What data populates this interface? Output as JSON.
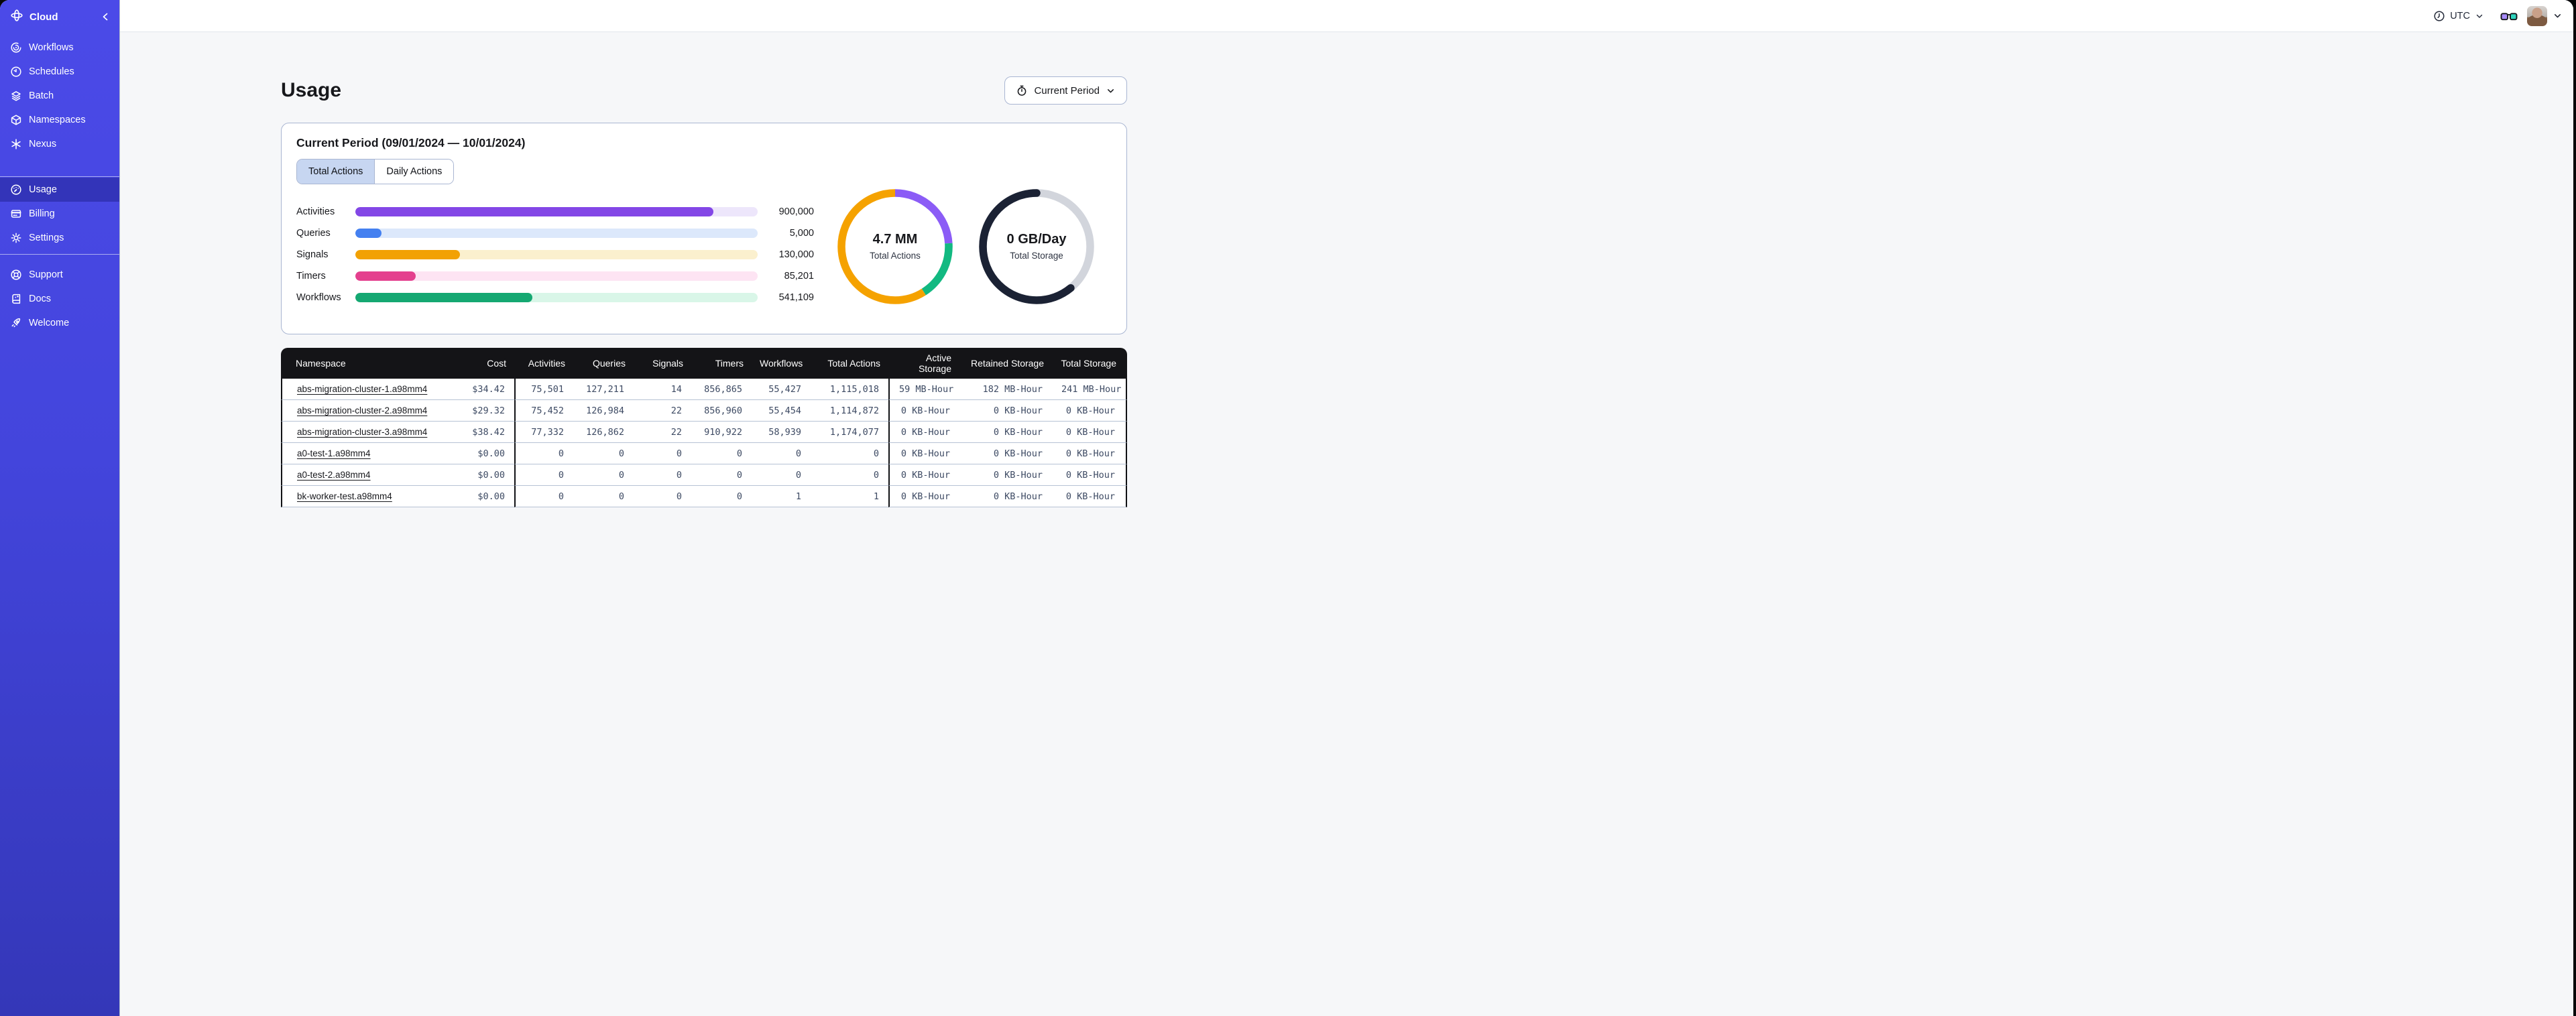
{
  "sidebar": {
    "brand": {
      "label": "Cloud"
    },
    "primary": [
      {
        "label": "Workflows"
      },
      {
        "label": "Schedules"
      },
      {
        "label": "Batch"
      },
      {
        "label": "Namespaces"
      },
      {
        "label": "Nexus"
      }
    ],
    "account": [
      {
        "label": "Usage",
        "active": true
      },
      {
        "label": "Billing",
        "active": false
      },
      {
        "label": "Settings",
        "active": false
      }
    ],
    "footer": [
      {
        "label": "Support"
      },
      {
        "label": "Docs"
      },
      {
        "label": "Welcome"
      }
    ]
  },
  "topbar": {
    "timezone": "UTC"
  },
  "page": {
    "title": "Usage",
    "period_selector_label": "Current Period"
  },
  "panel": {
    "title": "Current Period (09/01/2024 — 10/01/2024)",
    "tabs": [
      {
        "label": "Total Actions",
        "active": true
      },
      {
        "label": "Daily Actions",
        "active": false
      }
    ]
  },
  "chart_data": [
    {
      "type": "bar",
      "categories": [
        "Activities",
        "Queries",
        "Signals",
        "Timers",
        "Workflows"
      ],
      "values": [
        900000,
        5000,
        130000,
        85201,
        541109
      ],
      "display_values": [
        "900,000",
        "5,000",
        "130,000",
        "85,201",
        "541,109"
      ],
      "percent_filled": [
        89,
        6.5,
        26,
        15,
        44
      ],
      "colors": [
        "#8347E6",
        "#4480F0",
        "#F2A104",
        "#E4408E",
        "#15A872"
      ],
      "track_colors": [
        "#EDE6FB",
        "#DCE8FB",
        "#FBF0CE",
        "#FDE4F3",
        "#D9F6E8"
      ]
    },
    {
      "type": "donut",
      "center_value": "4.7 MM",
      "center_label": "Total Actions",
      "segments": [
        {
          "name": "workflows-purple",
          "color": "#8B5CF6",
          "fraction": 0.24
        },
        {
          "name": "green",
          "color": "#12B981",
          "fraction": 0.17
        },
        {
          "name": "orange",
          "color": "#F5A200",
          "fraction": 0.59
        }
      ],
      "rounded_caps": false
    },
    {
      "type": "donut",
      "center_value": "0 GB/Day",
      "center_label": "Total Storage",
      "base_color": "#D2D5DC",
      "arc": {
        "color": "#1B2234",
        "fraction": 0.61,
        "start": 0.39
      },
      "rounded_caps": true
    }
  ],
  "table": {
    "columns": [
      "Namespace",
      "Cost",
      "Activities",
      "Queries",
      "Signals",
      "Timers",
      "Workflows",
      "Total Actions",
      "Active Storage",
      "Retained Storage",
      "Total Storage"
    ],
    "rows": [
      [
        "abs-migration-cluster-1.a98mm4",
        "$34.42",
        "75,501",
        "127,211",
        "14",
        "856,865",
        "55,427",
        "1,115,018",
        "59 MB-Hour",
        "182 MB-Hour",
        "241 MB-Hour"
      ],
      [
        "abs-migration-cluster-2.a98mm4",
        "$29.32",
        "75,452",
        "126,984",
        "22",
        "856,960",
        "55,454",
        "1,114,872",
        "0 KB-Hour",
        "0 KB-Hour",
        "0 KB-Hour"
      ],
      [
        "abs-migration-cluster-3.a98mm4",
        "$38.42",
        "77,332",
        "126,862",
        "22",
        "910,922",
        "58,939",
        "1,174,077",
        "0 KB-Hour",
        "0 KB-Hour",
        "0 KB-Hour"
      ],
      [
        "a0-test-1.a98mm4",
        "$0.00",
        "0",
        "0",
        "0",
        "0",
        "0",
        "0",
        "0 KB-Hour",
        "0 KB-Hour",
        "0 KB-Hour"
      ],
      [
        "a0-test-2.a98mm4",
        "$0.00",
        "0",
        "0",
        "0",
        "0",
        "0",
        "0",
        "0 KB-Hour",
        "0 KB-Hour",
        "0 KB-Hour"
      ],
      [
        "bk-worker-test.a98mm4",
        "$0.00",
        "0",
        "0",
        "0",
        "0",
        "1",
        "1",
        "0 KB-Hour",
        "0 KB-Hour",
        "0 KB-Hour"
      ]
    ]
  },
  "colors": {
    "sidebar_indigo_top": "#4B4AE8",
    "sidebar_indigo_bottom": "#3437B8",
    "active_tab_blue": "#C7D6F1",
    "card_border": "#A9B6D2",
    "table_header_bg": "#141417",
    "table_number_text": "#3D4A63",
    "glasses_left_lens": "#A78BFA",
    "glasses_right_lens": "#2FD4BE"
  }
}
